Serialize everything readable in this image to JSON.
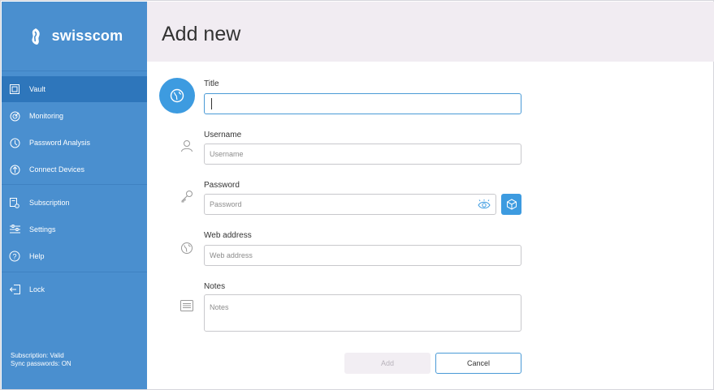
{
  "brand": {
    "name": "swisscom"
  },
  "sidebar": {
    "items": [
      {
        "label": "Vault",
        "icon": "vault-icon",
        "active": true
      },
      {
        "label": "Monitoring",
        "icon": "monitoring-icon",
        "active": false
      },
      {
        "label": "Password Analysis",
        "icon": "password-analysis-icon",
        "active": false
      },
      {
        "label": "Connect Devices",
        "icon": "connect-devices-icon",
        "active": false
      },
      {
        "label": "Subscription",
        "icon": "subscription-icon",
        "active": false
      },
      {
        "label": "Settings",
        "icon": "settings-icon",
        "active": false
      },
      {
        "label": "Help",
        "icon": "help-icon",
        "active": false
      },
      {
        "label": "Lock",
        "icon": "lock-icon",
        "active": false
      }
    ],
    "status": {
      "subscription": "Subscription: Valid",
      "sync": "Sync passwords: ON"
    }
  },
  "header": {
    "title": "Add new"
  },
  "form": {
    "title": {
      "label": "Title",
      "value": "",
      "placeholder": ""
    },
    "username": {
      "label": "Username",
      "placeholder": "Username"
    },
    "password": {
      "label": "Password",
      "placeholder": "Password"
    },
    "web_address": {
      "label": "Web address",
      "placeholder": "Web address"
    },
    "notes": {
      "label": "Notes",
      "placeholder": "Notes"
    }
  },
  "actions": {
    "add_label": "Add",
    "cancel_label": "Cancel"
  },
  "colors": {
    "sidebar": "#4a8fcf",
    "sidebar_active": "#2e76bb",
    "accent": "#3d9be0",
    "header_bg": "#f1ecf2"
  }
}
